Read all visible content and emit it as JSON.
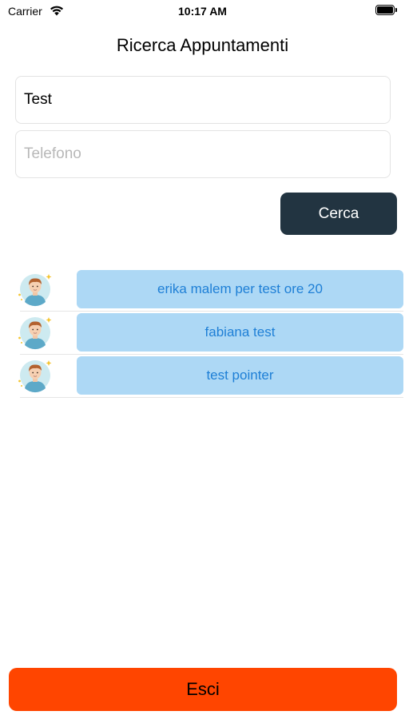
{
  "status_bar": {
    "carrier": "Carrier",
    "time": "10:17 AM",
    "icons": [
      "wifi-icon",
      "battery-icon"
    ]
  },
  "page": {
    "title": "Ricerca Appuntamenti"
  },
  "search": {
    "name_value": "Test",
    "phone_value": "",
    "phone_placeholder": "Telefono",
    "button_label": "Cerca"
  },
  "results": [
    {
      "avatar_icon": "user-avatar-icon",
      "label": "erika malem per test ore 20"
    },
    {
      "avatar_icon": "user-avatar-icon",
      "label": "fabiana test"
    },
    {
      "avatar_icon": "user-avatar-icon",
      "label": "test pointer"
    }
  ],
  "footer": {
    "exit_label": "Esci"
  },
  "colors": {
    "search_button": "#223441",
    "result_button_bg": "#add8f5",
    "result_button_text": "#1e7fd6",
    "exit_button": "#ff4500"
  }
}
